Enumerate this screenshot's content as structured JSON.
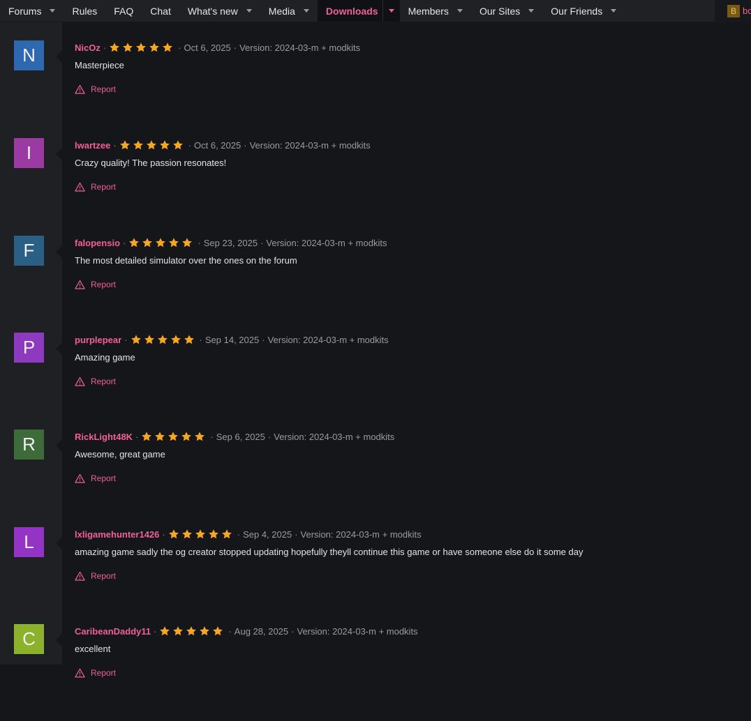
{
  "nav": {
    "items": [
      {
        "label": "Forums",
        "dropdown": true
      },
      {
        "label": "Rules",
        "dropdown": false
      },
      {
        "label": "FAQ",
        "dropdown": false
      },
      {
        "label": "Chat",
        "dropdown": false
      },
      {
        "label": "What's new",
        "dropdown": true
      },
      {
        "label": "Media",
        "dropdown": true
      },
      {
        "label": "Downloads",
        "dropdown": true,
        "active": true
      },
      {
        "label": "Members",
        "dropdown": true
      },
      {
        "label": "Our Sites",
        "dropdown": true
      },
      {
        "label": "Our Friends",
        "dropdown": true
      }
    ],
    "user_initial": "B",
    "user_name_partial": "bo"
  },
  "review_actions": {
    "report_label": "Report"
  },
  "colors": {
    "accent": "#f0609a",
    "star": "#f5a623"
  },
  "reviews": [
    {
      "initial": "N",
      "avatar_color": "#2d68b0",
      "username": "NicOz",
      "rating": 5,
      "date": "Oct 6, 2025",
      "version": "Version: 2024-03-m + modkits",
      "text": "Masterpiece"
    },
    {
      "initial": "I",
      "avatar_color": "#9b3aa0",
      "username": "lwartzee",
      "rating": 5,
      "date": "Oct 6, 2025",
      "version": "Version: 2024-03-m + modkits",
      "text": "Crazy quality! The passion resonates!"
    },
    {
      "initial": "F",
      "avatar_color": "#2a5f86",
      "username": "falopensio",
      "rating": 5,
      "date": "Sep 23, 2025",
      "version": "Version: 2024-03-m + modkits",
      "text": "The most detailed simulator over the ones on the forum"
    },
    {
      "initial": "P",
      "avatar_color": "#8e3ac0",
      "username": "purplepear",
      "rating": 5,
      "date": "Sep 14, 2025",
      "version": "Version: 2024-03-m + modkits",
      "text": "Amazing game"
    },
    {
      "initial": "R",
      "avatar_color": "#3d6b3a",
      "username": "RickLight48K",
      "rating": 5,
      "date": "Sep 6, 2025",
      "version": "Version: 2024-03-m + modkits",
      "text": "Awesome, great game"
    },
    {
      "initial": "L",
      "avatar_color": "#9434c4",
      "username": "lxligamehunter1426",
      "rating": 5,
      "date": "Sep 4, 2025",
      "version": "Version: 2024-03-m + modkits",
      "text": "amazing game sadly the og creator stopped updating hopefully theyll continue this game or have someone else do it some day"
    },
    {
      "initial": "C",
      "avatar_color": "#8bb22a",
      "username": "CaribeanDaddy11",
      "rating": 5,
      "date": "Aug 28, 2025",
      "version": "Version: 2024-03-m + modkits",
      "text": "excellent"
    }
  ]
}
